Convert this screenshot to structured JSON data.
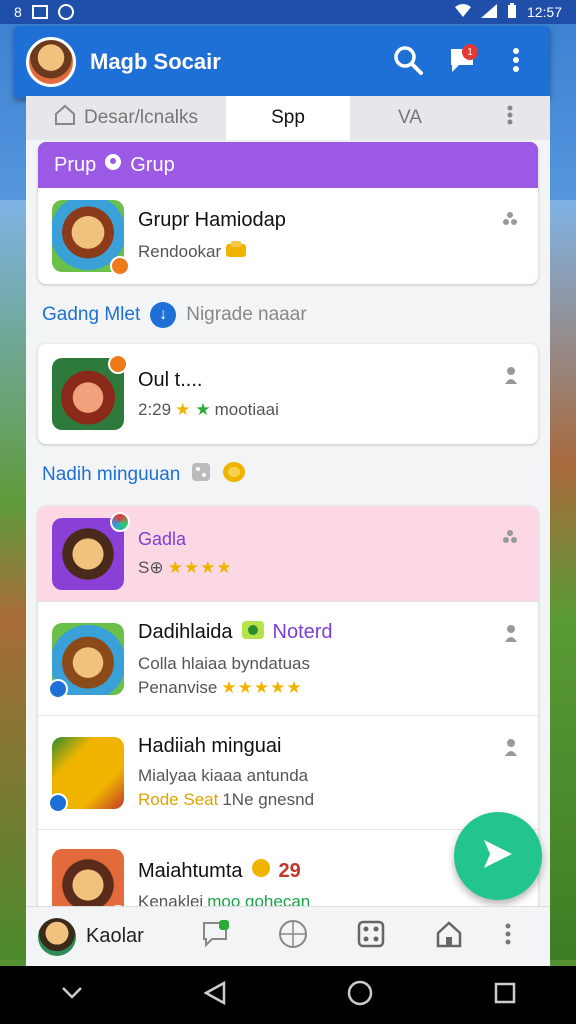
{
  "status_bar": {
    "left_text": "8",
    "time": "12:57"
  },
  "app_bar": {
    "title": "Magb Socair",
    "notification_count": "1"
  },
  "tabs": [
    {
      "label": "Desar/lcnalks"
    },
    {
      "label": "Spp"
    },
    {
      "label": "VA"
    }
  ],
  "group": {
    "header": "Prup",
    "header_badge": "Grup",
    "item": {
      "title": "Grupr Hamiodap",
      "subtitle": "Rendookar"
    }
  },
  "section1": {
    "label": "Gadng Mlet",
    "note": "Nigrade naaar"
  },
  "item2": {
    "title": "Oul t....",
    "meta_time": "2:29",
    "meta_text": "mootiaai"
  },
  "section2": {
    "label": "Nadih minguuan"
  },
  "list": [
    {
      "title": "Gadla",
      "subtitle": "S⊕",
      "stars": "★★★★",
      "highlight": true
    },
    {
      "title": "Dadihlaida",
      "tag": "Noterd",
      "line2": "Colla hlaiaa byndatuas",
      "line3": "Penanvise",
      "stars": "★★★★★"
    },
    {
      "title": "Hadiiah minguai",
      "line2": "Mialyaa kiaaa antunda",
      "line3": "Rode Seat",
      "line3b": "1Ne gnesnd"
    },
    {
      "title": "Maiahtumta",
      "badge": "29",
      "line2": "Kenaklei",
      "line2b": "moo gohecan"
    }
  ],
  "bottom_nav": {
    "label": "Kaolar"
  },
  "colors": {
    "primary": "#1e6fd6",
    "group_header": "#9b59e6",
    "fab": "#22c58b",
    "highlight_row": "#fbd8e3"
  }
}
